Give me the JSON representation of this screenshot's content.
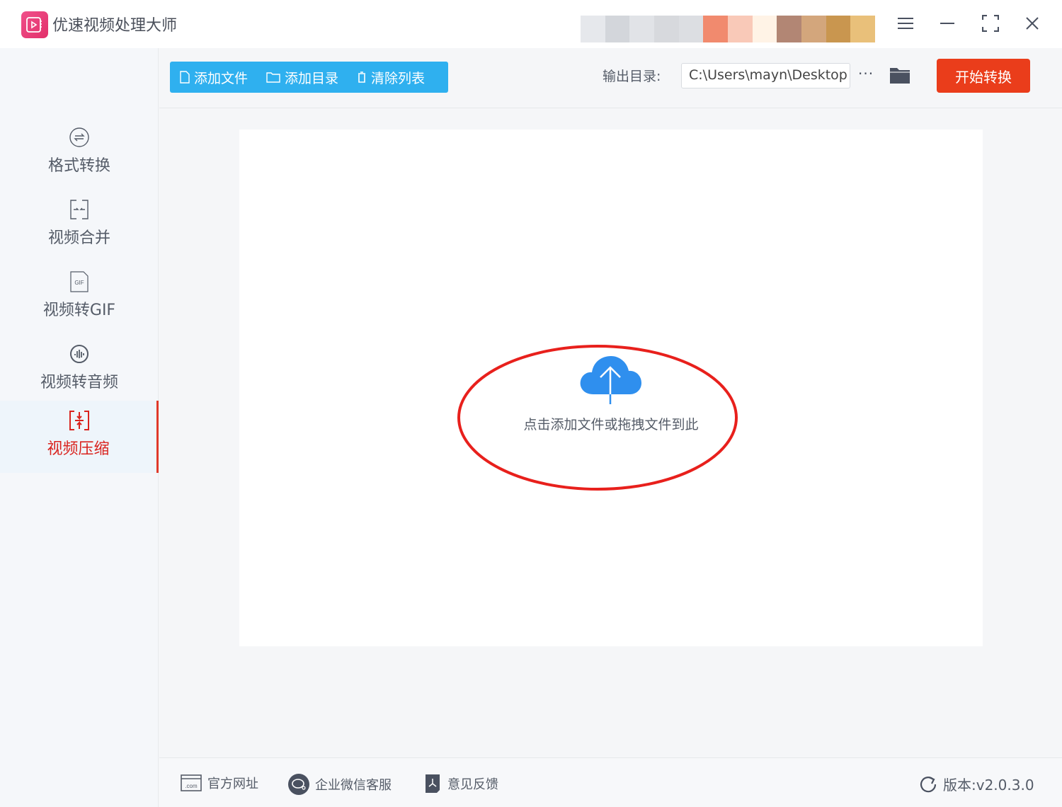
{
  "app": {
    "title": "优速视频处理大师"
  },
  "window": {
    "menu": "menu-icon",
    "minimize": "minimize-icon",
    "maximize": "maximize-icon",
    "close": "close-icon"
  },
  "toolbar": {
    "add_file": "添加文件",
    "add_folder": "添加目录",
    "clear_list": "清除列表",
    "output_label": "输出目录:",
    "output_path": "C:\\Users\\mayn\\Desktop",
    "more": "···",
    "start": "开始转换"
  },
  "sidebar": {
    "items": [
      {
        "label": "格式转换",
        "icon": "convert-icon"
      },
      {
        "label": "视频合并",
        "icon": "merge-icon"
      },
      {
        "label": "视频转GIF",
        "icon": "gif-file-icon",
        "icon_text": "GIF"
      },
      {
        "label": "视频转音频",
        "icon": "audio-icon"
      },
      {
        "label": "视频压缩",
        "icon": "compress-icon",
        "active": true
      }
    ]
  },
  "dropzone": {
    "text": "点击添加文件或拖拽文件到此"
  },
  "footer": {
    "website": "官方网址",
    "website_icon_text": ".com",
    "wechat": "企业微信客服",
    "feedback": "意见反馈",
    "version": "版本:v2.0.3.0"
  },
  "colors": {
    "accent": "#2fb0ef",
    "start": "#ea3d1b",
    "active": "#d9231e",
    "annotation": "#e8201c"
  }
}
